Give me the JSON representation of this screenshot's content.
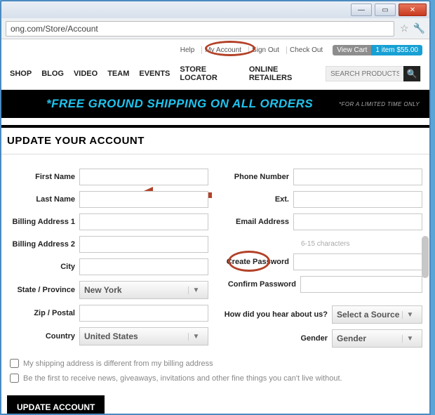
{
  "browser": {
    "url": "ong.com/Store/Account"
  },
  "top_links": {
    "help": "Help",
    "my_account": "My Account",
    "sign_out": "Sign Out",
    "check_out": "Check Out",
    "view_cart": "View Cart",
    "cart_summary": "1 item $55.00"
  },
  "nav": {
    "items": [
      "SHOP",
      "BLOG",
      "VIDEO",
      "TEAM",
      "EVENTS",
      "STORE LOCATOR",
      "ONLINE RETAILERS"
    ],
    "search_placeholder": "SEARCH PRODUCTS"
  },
  "banner": {
    "message": "*FREE GROUND SHIPPING ON ALL ORDERS",
    "sub": "*FOR A LIMITED TIME ONLY"
  },
  "page": {
    "title": "UPDATE YOUR ACCOUNT"
  },
  "labels": {
    "first_name": "First Name",
    "last_name": "Last Name",
    "billing1": "Billing Address 1",
    "billing2": "Billing Address 2",
    "city": "City",
    "state": "State / Province",
    "zip": "Zip / Postal",
    "country": "Country",
    "phone": "Phone Number",
    "ext": "Ext.",
    "email": "Email Address",
    "create_pw": "Create Password",
    "confirm_pw": "Confirm Password",
    "pw_hint": "6-15 characters",
    "hear": "How did you hear about us?",
    "gender": "Gender"
  },
  "selects": {
    "state": "New York",
    "country": "United States",
    "source": "Select a Source",
    "gender": "Gender"
  },
  "checkboxes": {
    "shipping_diff": "My shipping address is different from my billing address",
    "newsletter": "Be the first to receive news, giveaways, invitations and other fine things you can't live without."
  },
  "buttons": {
    "update": "UPDATE ACCOUNT"
  }
}
